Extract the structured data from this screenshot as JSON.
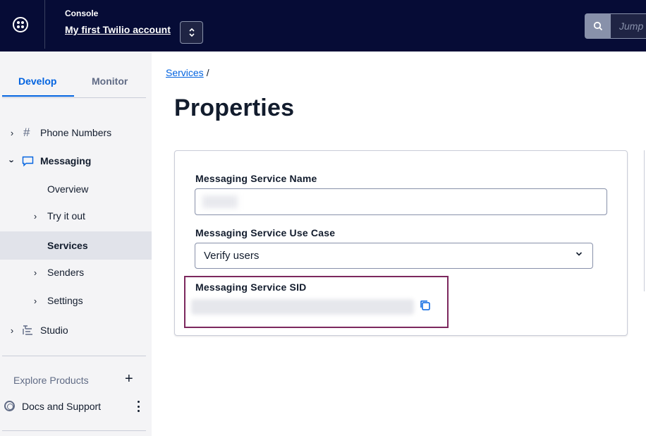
{
  "topbar": {
    "console_label": "Console",
    "account_name": "My first Twilio account",
    "search_placeholder": "Jump to...",
    "icons": [
      "twilio-logo-icon",
      "chevron-updown-icon",
      "search-icon"
    ]
  },
  "sidebar": {
    "tabs": [
      {
        "label": "Develop",
        "active": true
      },
      {
        "label": "Monitor",
        "active": false
      }
    ],
    "items": [
      {
        "label": "Phone Numbers",
        "icon": "hash-icon",
        "expanded": false
      },
      {
        "label": "Messaging",
        "icon": "chat-bubble-icon",
        "expanded": true
      },
      {
        "label": "Overview"
      },
      {
        "label": "Try it out",
        "expanded": false
      },
      {
        "label": "Services",
        "active": true
      },
      {
        "label": "Senders",
        "expanded": false
      },
      {
        "label": "Settings",
        "expanded": false
      },
      {
        "label": "Studio",
        "icon": "studio-flow-icon",
        "expanded": false
      }
    ],
    "explore_label": "Explore Products",
    "docs_label": "Docs and Support"
  },
  "main": {
    "breadcrumb": {
      "link": "Services",
      "separator": "/"
    },
    "title": "Properties",
    "fields": {
      "name_label": "Messaging Service Name",
      "use_case_label": "Messaging Service Use Case",
      "use_case_value": "Verify users",
      "sid_label": "Messaging Service SID"
    }
  },
  "colors": {
    "topbar_bg": "#060c36",
    "accent": "#0263e0",
    "highlight_border": "#7c285e",
    "sidebar_bg": "#f4f4f6"
  }
}
